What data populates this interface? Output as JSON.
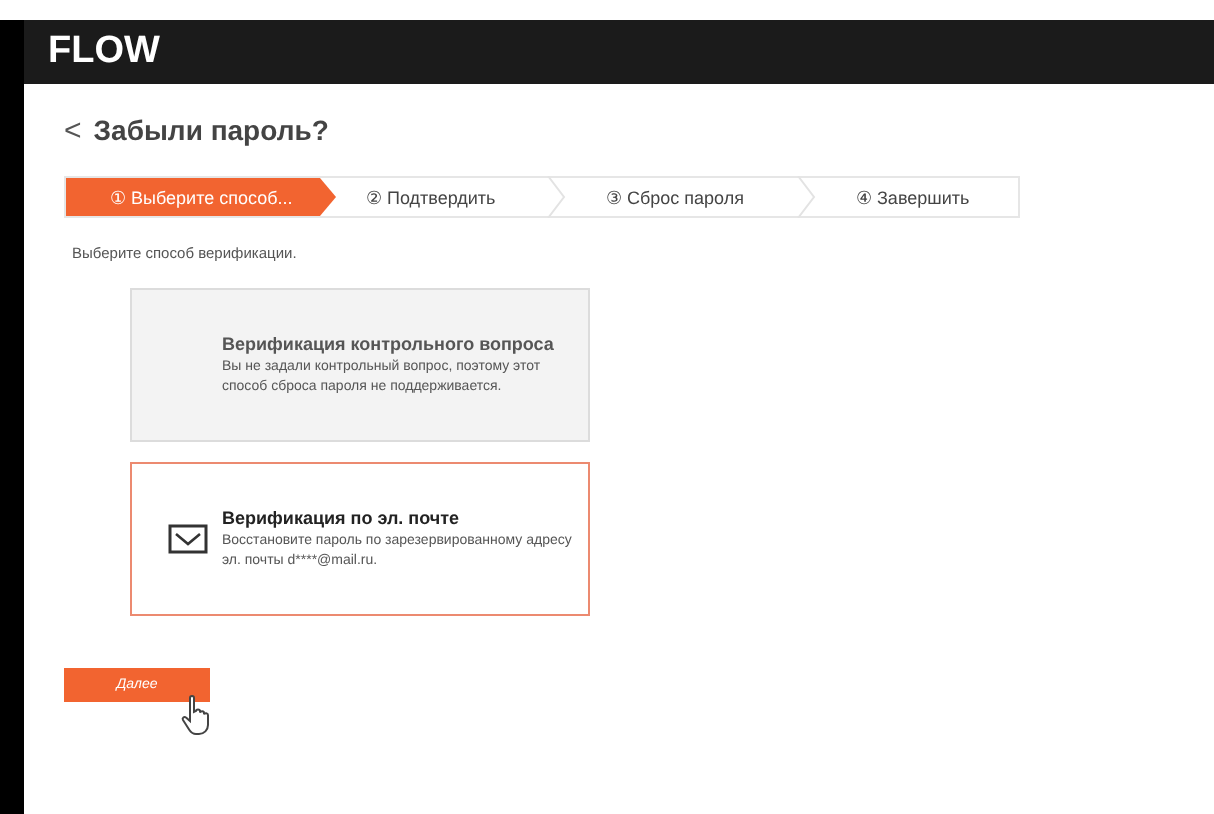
{
  "header": {
    "logo": "FLOW"
  },
  "page": {
    "back": "<",
    "title": "Забыли пароль?"
  },
  "steps": [
    {
      "label": "① Выберите способ...",
      "selected": true
    },
    {
      "label": "② Подтвердить",
      "selected": false
    },
    {
      "label": "③ Сброс пароля",
      "selected": false
    },
    {
      "label": "④ Завершить",
      "selected": false
    }
  ],
  "instruction": "Выберите способ верификации.",
  "options": [
    {
      "kind": "question",
      "title": "Верификация контрольного вопроса",
      "description": "Вы не задали контрольный вопрос, поэтому этот способ сброса пароля не поддерживается.",
      "selected": false,
      "disabled": true
    },
    {
      "kind": "email",
      "title": "Верификация по эл. почте",
      "description": "Восстановите пароль по зарезервированному адресу эл. почты d****@mail.ru.",
      "selected": true,
      "disabled": false
    }
  ],
  "next_button": "Далее"
}
